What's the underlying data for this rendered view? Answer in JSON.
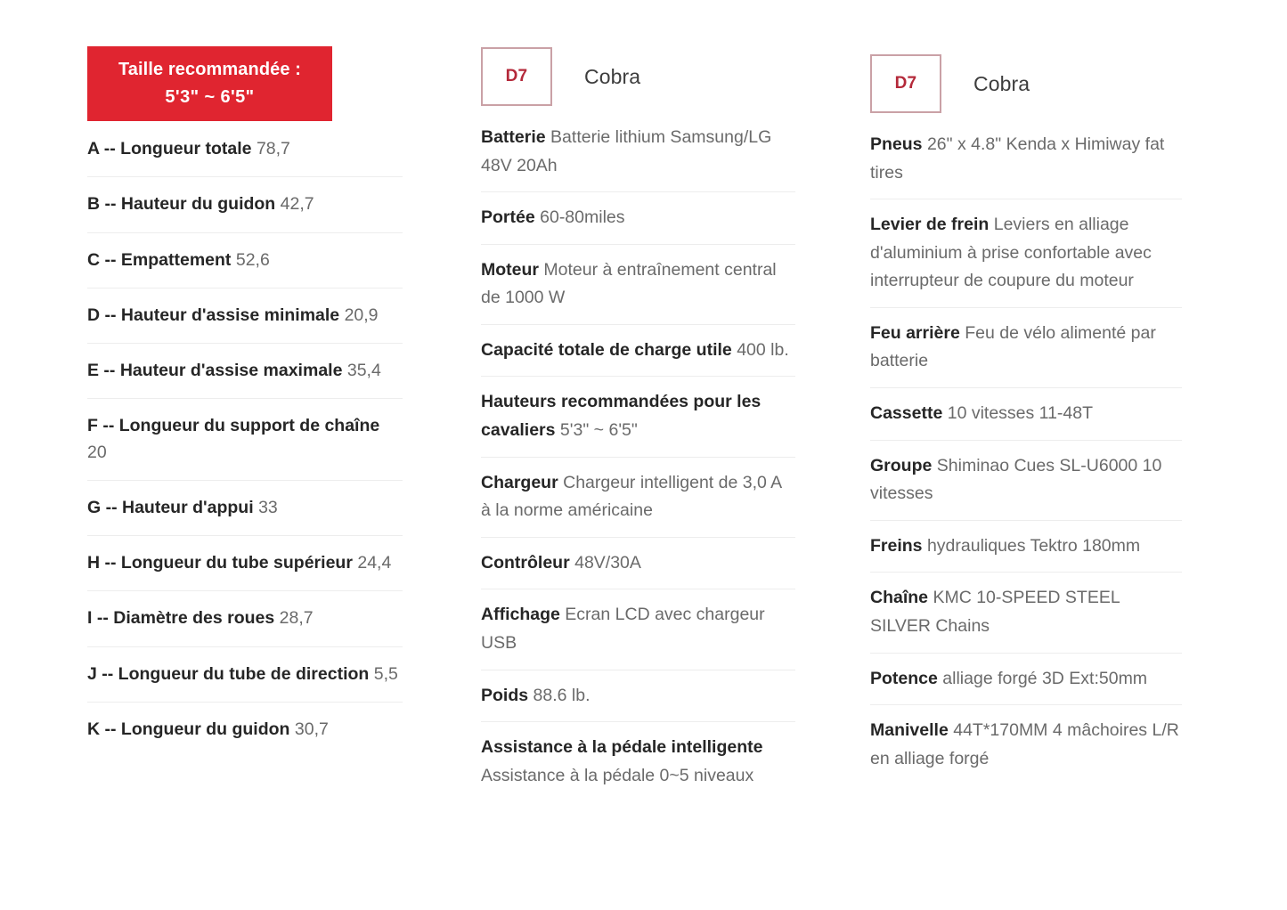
{
  "size_banner": {
    "title": "Taille recommandée :",
    "range": "5'3\" ~ 6'5\""
  },
  "geometry_column": {
    "rows": [
      {
        "label": "A -- Longueur totale",
        "value": "78,7"
      },
      {
        "label": "B -- Hauteur du guidon",
        "value": "42,7"
      },
      {
        "label": "C -- Empattement",
        "value": "52,6"
      },
      {
        "label": "D -- Hauteur d'assise minimale",
        "value": "20,9"
      },
      {
        "label": "E -- Hauteur d'assise maximale",
        "value": "35,4"
      },
      {
        "label": "F -- Longueur du support de chaîne",
        "value": "20"
      },
      {
        "label": "G -- Hauteur d'appui",
        "value": "33"
      },
      {
        "label": "H -- Longueur du tube supérieur",
        "value": "24,4"
      },
      {
        "label": "I -- Diamètre des roues",
        "value": "28,7"
      },
      {
        "label": "J -- Longueur du tube de direction",
        "value": "5,5"
      },
      {
        "label": "K -- Longueur du guidon",
        "value": "30,7"
      }
    ]
  },
  "spec_column_a": {
    "badge": "D7",
    "model": "Cobra",
    "rows": [
      {
        "label": "Batterie",
        "value": "Batterie lithium Samsung/LG 48V 20Ah"
      },
      {
        "label": "Portée",
        "value": "60-80miles"
      },
      {
        "label": "Moteur",
        "value": "Moteur à entraînement central de 1000 W"
      },
      {
        "label": "Capacité totale de charge utile",
        "value": "400 lb."
      },
      {
        "label": "Hauteurs recommandées pour les cavaliers",
        "value": "5'3\" ~ 6'5\""
      },
      {
        "label": "Chargeur",
        "value": "Chargeur intelligent de 3,0 A à la norme américaine"
      },
      {
        "label": "Contrôleur",
        "value": "48V/30A"
      },
      {
        "label": "Affichage",
        "value": "Ecran LCD avec chargeur USB"
      },
      {
        "label": "Poids",
        "value": "88.6 lb."
      },
      {
        "label": "Assistance à la pédale intelligente",
        "value": "Assistance à la pédale 0~5 niveaux"
      }
    ]
  },
  "spec_column_b": {
    "badge": "D7",
    "model": "Cobra",
    "rows": [
      {
        "label": "Pneus",
        "value": "26\" x 4.8\" Kenda x Himiway fat tires"
      },
      {
        "label": "Levier de frein",
        "value": "Leviers en alliage d'aluminium à prise confortable avec interrupteur de coupure du moteur"
      },
      {
        "label": "Feu arrière",
        "value": "Feu de vélo alimenté par batterie"
      },
      {
        "label": "Cassette",
        "value": "10 vitesses 11-48T"
      },
      {
        "label": "Groupe",
        "value": "Shiminao Cues SL-U6000 10 vitesses"
      },
      {
        "label": "Freins",
        "value": "hydrauliques Tektro 180mm"
      },
      {
        "label": "Chaîne",
        "value": "KMC 10-SPEED STEEL SILVER Chains"
      },
      {
        "label": "Potence",
        "value": "alliage forgé 3D Ext:50mm"
      },
      {
        "label": "Manivelle",
        "value": "44T*170MM 4 mâchoires L/R en alliage forgé"
      }
    ]
  },
  "colors": {
    "banner_red": "#e02530",
    "badge_text_red": "#b4293a",
    "badge_border": "#caa1a6",
    "divider": "#ededed",
    "label_text": "#262626",
    "value_text": "#6a6a6a"
  }
}
